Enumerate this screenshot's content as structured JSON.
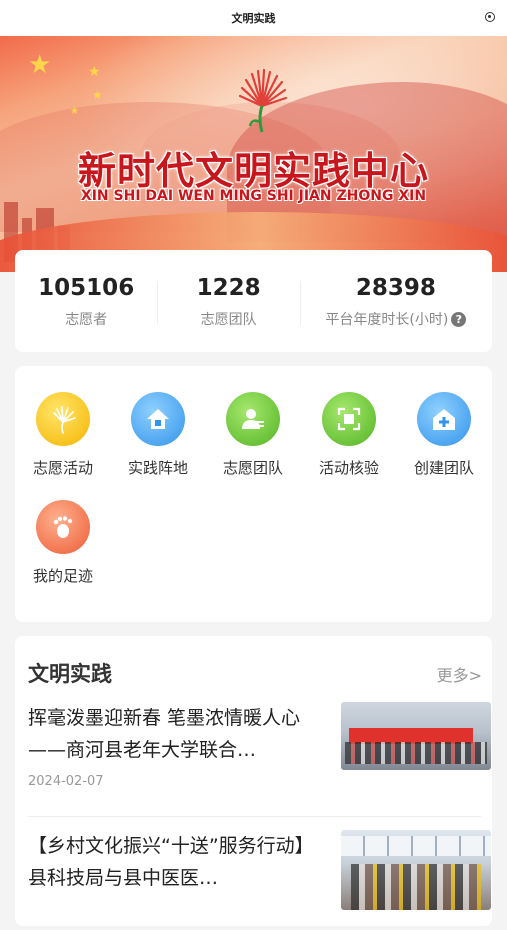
{
  "topbar": {
    "title": "文明实践"
  },
  "banner": {
    "title": "新时代文明实践中心",
    "pinyin": "XIN SHI DAI WEN MING SHI JIAN ZHONG XIN"
  },
  "stats": [
    {
      "value": "105106",
      "label": "志愿者"
    },
    {
      "value": "1228",
      "label": "志愿团队"
    },
    {
      "value": "28398",
      "label": "平台年度时长(小时)"
    }
  ],
  "menu": [
    {
      "label": "志愿活动",
      "icon": "volunteer-activity-icon",
      "color": "#f7c21e"
    },
    {
      "label": "实践阵地",
      "icon": "home-icon",
      "color": "#4aa8f2"
    },
    {
      "label": "志愿团队",
      "icon": "team-icon",
      "color": "#6cc93a"
    },
    {
      "label": "活动核验",
      "icon": "scan-icon",
      "color": "#6cc93a"
    },
    {
      "label": "创建团队",
      "icon": "create-team-icon",
      "color": "#4aa8f2"
    },
    {
      "label": "我的足迹",
      "icon": "footprint-icon",
      "color": "#f07a55"
    }
  ],
  "news": {
    "heading": "文明实践",
    "more": "更多>",
    "items": [
      {
        "title": "挥毫泼墨迎新春 笔墨浓情暖人心——商河县老年大学联合…",
        "date": "2024-02-07"
      },
      {
        "title": "【乡村文化振兴“十送”服务行动】县科技局与县中医医…",
        "date": ""
      }
    ]
  }
}
